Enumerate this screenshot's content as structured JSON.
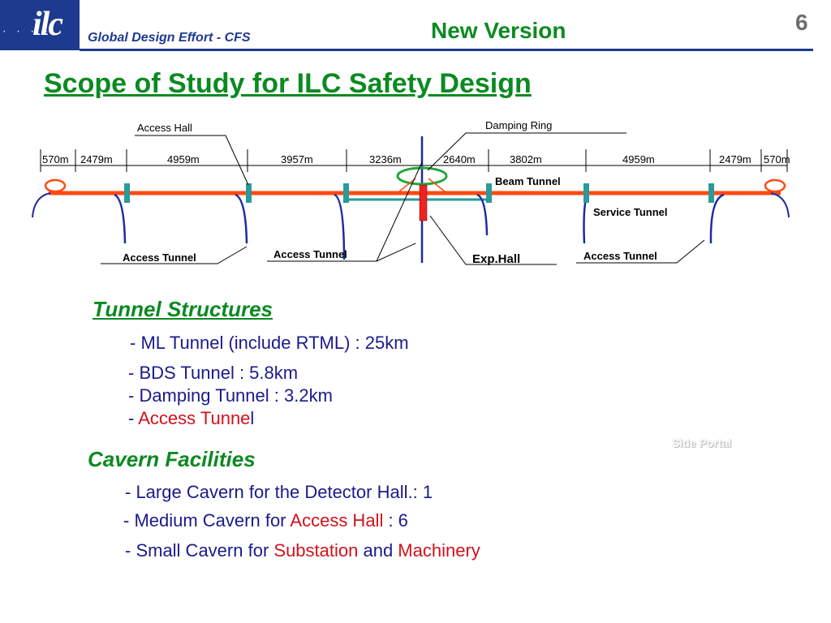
{
  "header": {
    "logo_text": "ilc",
    "logo_dots": "· · · · ·",
    "organization": "Global Design Effort - CFS",
    "version": "New Version",
    "page_number": "6"
  },
  "title": "Scope of Study for ILC Safety Design",
  "diagram": {
    "distances": [
      "570m",
      "2479m",
      "4959m",
      "3957m",
      "3236m",
      "2640m",
      "3802m",
      "4959m",
      "2479m",
      "570m"
    ],
    "labels": {
      "access_hall": "Access Hall",
      "damping_ring": "Damping Ring",
      "beam_tunnel": "Beam Tunnel",
      "service_tunnel": "Service Tunnel",
      "access_tunnel": "Access Tunnel",
      "exp_hall": "Exp.Hall"
    },
    "colors": {
      "beam": "#ff4a12",
      "shaft": "#2a9a9a",
      "tunnel": "#1c2aa3",
      "exp_hall": "#ee2222",
      "damping_ring": "#22a83a"
    }
  },
  "tunnel_structures": {
    "heading": "Tunnel Structures",
    "item1": "- ML Tunnel (include RTML) : 25km",
    "item2": "- BDS Tunnel : 5.8km",
    "item3": "- Damping Tunnel : 3.2km",
    "item4_prefix": "- ",
    "item4_red": "Access Tunne",
    "item4_suffix": "l"
  },
  "side_portal": "Side Portal",
  "cavern_facilities": {
    "heading": "Cavern Facilities",
    "item1": "- Large Cavern for  the Detector Hall.: 1",
    "item2_prefix": "- Medium Cavern for ",
    "item2_red": "Access Hall",
    "item2_suffix": " : 6",
    "item3_prefix": "- Small Cavern for ",
    "item3_red1": "Substation",
    "item3_mid": " and ",
    "item3_red2": "Machinery"
  }
}
